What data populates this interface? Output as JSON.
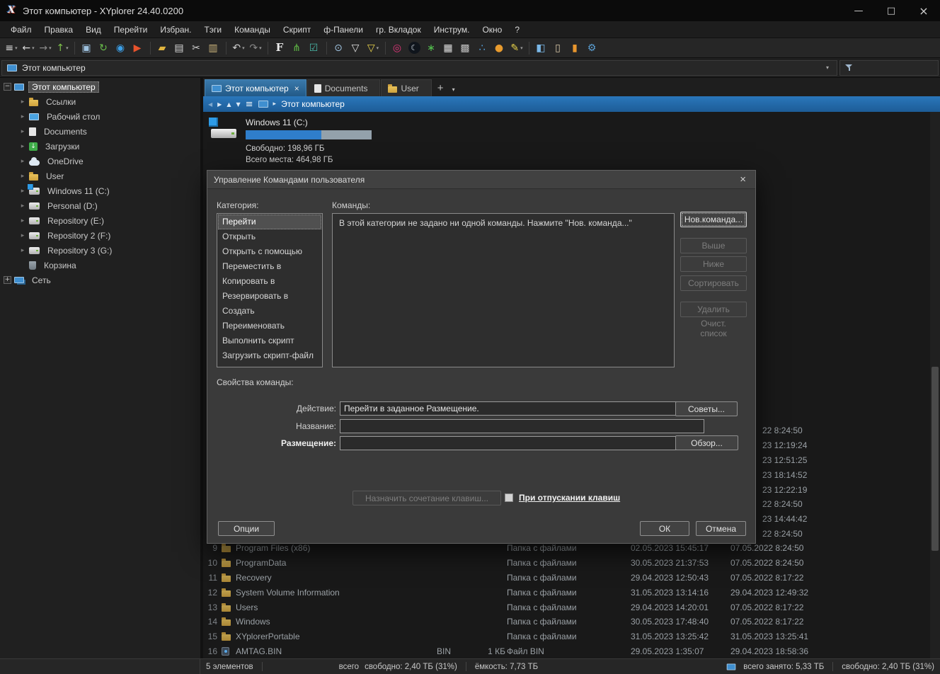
{
  "window": {
    "title": "Этот компьютер - XYplorer 24.40.0200",
    "minimize": "—",
    "maximize": "□",
    "close": "×"
  },
  "menu": {
    "items": [
      {
        "label": "Файл"
      },
      {
        "label": "Правка"
      },
      {
        "label": "Вид"
      },
      {
        "label": "Перейти"
      },
      {
        "label": "Избран."
      },
      {
        "label": "Тэги"
      },
      {
        "label": "Команды"
      },
      {
        "label": "Скрипт"
      },
      {
        "label": "ф-Панели"
      },
      {
        "label": "гр. Вкладок"
      },
      {
        "label": "Инструм."
      },
      {
        "label": "Окно"
      },
      {
        "label": "?"
      }
    ]
  },
  "toolbar": {
    "items": [
      {
        "name": "menu-button",
        "glyph": "≡",
        "color": "#e0e0e0",
        "caret": "▾"
      },
      {
        "name": "back-button",
        "glyph": "←",
        "color": "#d8d8d8",
        "caret": "▾"
      },
      {
        "name": "forward-button",
        "glyph": "→",
        "color": "#8a8a8a",
        "caret": "▾"
      },
      {
        "name": "up-button",
        "glyph": "↑",
        "color": "#7ec24a",
        "caret": "▾"
      },
      {
        "name": "toolbar-separator",
        "cls": "sep"
      },
      {
        "name": "screen-button",
        "glyph": "▣",
        "color": "#9fc3e0"
      },
      {
        "name": "refresh-button",
        "glyph": "↻",
        "color": "#6abf4b"
      },
      {
        "name": "zoom-button",
        "glyph": "◉",
        "color": "#3b9fe8"
      },
      {
        "name": "go-button",
        "glyph": "▶",
        "color": "#e8532c"
      },
      {
        "name": "toolbar-separator",
        "cls": "sep"
      },
      {
        "name": "new-folder-button",
        "glyph": "▰",
        "color": "#e0b43e"
      },
      {
        "name": "copy-button",
        "glyph": "▤",
        "color": "#d8d8d8"
      },
      {
        "name": "cut-button",
        "glyph": "✂",
        "color": "#d0d0d0"
      },
      {
        "name": "paste-button",
        "glyph": "▥",
        "color": "#c9b27a"
      },
      {
        "name": "toolbar-separator",
        "cls": "sep"
      },
      {
        "name": "undo-button",
        "glyph": "↶",
        "color": "#d0d0d0",
        "caret": "▾"
      },
      {
        "name": "redo-button",
        "glyph": "↷",
        "color": "#8a8a8a",
        "caret": "▾"
      },
      {
        "name": "toolbar-separator",
        "cls": "sep"
      },
      {
        "name": "font-button",
        "glyph": "F",
        "color": "#ececec",
        "cls": "serif"
      },
      {
        "name": "tree-style-button",
        "glyph": "⋔",
        "color": "#5fba46"
      },
      {
        "name": "checkbox-select-button",
        "glyph": "☑",
        "color": "#49b8a8"
      },
      {
        "name": "toolbar-separator",
        "cls": "sep"
      },
      {
        "name": "find-files-button",
        "glyph": "⊙",
        "color": "#9fc3e0"
      },
      {
        "name": "filter-button",
        "glyph": "▽",
        "color": "#e0e0e0"
      },
      {
        "name": "visual-filter-button",
        "glyph": "▽",
        "color": "#e8d24a",
        "caret": "▾"
      },
      {
        "name": "toolbar-separator",
        "cls": "sep"
      },
      {
        "name": "hotlist-button",
        "glyph": "◎",
        "color": "#e2357a"
      },
      {
        "name": "dark-mode-button",
        "glyph": "☾",
        "color": "#cdd6e0",
        "cls": "moon"
      },
      {
        "name": "spot-button",
        "glyph": "∗",
        "color": "#54c24e"
      },
      {
        "name": "grid-button",
        "glyph": "▦",
        "color": "#e0e0e0"
      },
      {
        "name": "type-stats-button",
        "glyph": "▩",
        "color": "#c0c0c0"
      },
      {
        "name": "spray-button",
        "glyph": "∴",
        "color": "#58a8e8"
      },
      {
        "name": "color-filter-button",
        "glyph": "●",
        "color": "#e89b2e"
      },
      {
        "name": "highlight-button",
        "glyph": "✎",
        "color": "#e8d24a",
        "caret": "▾"
      },
      {
        "name": "toolbar-separator",
        "cls": "sep"
      },
      {
        "name": "dual-pane-button",
        "glyph": "◧",
        "color": "#7ab8e8"
      },
      {
        "name": "catalog-button",
        "glyph": "▯",
        "color": "#d8c8a8"
      },
      {
        "name": "panel-button",
        "glyph": "▮",
        "color": "#e8962e"
      },
      {
        "name": "settings-wrench-button",
        "glyph": "⚙",
        "color": "#5a9fd4"
      }
    ]
  },
  "addressbar": {
    "value": "Этот компьютер",
    "caret": "▾"
  },
  "tree": {
    "items": [
      {
        "name": "tree-item-this-computer",
        "label": "Этот компьютер",
        "exp": "−",
        "ic": "ic-computer",
        "cls": "lvl0 sel"
      },
      {
        "name": "tree-item-links",
        "label": "Ссылки",
        "exp": "▸",
        "ic": "ic-folder",
        "cls": "lvl1"
      },
      {
        "name": "tree-item-desktop",
        "label": "Рабочий стол",
        "exp": "▸",
        "ic": "ic-desktop",
        "cls": "lvl1"
      },
      {
        "name": "tree-item-documents",
        "label": "Documents",
        "exp": "▸",
        "ic": "ic-doc",
        "cls": "lvl1"
      },
      {
        "name": "tree-item-downloads",
        "label": "Загрузки",
        "exp": "▸",
        "ic": "ic-down",
        "cls": "lvl1"
      },
      {
        "name": "tree-item-onedrive",
        "label": "OneDrive",
        "exp": "▸",
        "ic": "ic-cloud",
        "cls": "lvl1"
      },
      {
        "name": "tree-item-user",
        "label": "User",
        "exp": "▸",
        "ic": "ic-folder",
        "cls": "lvl1"
      },
      {
        "name": "tree-item-drive-c",
        "label": "Windows 11 (C:)",
        "exp": "▸",
        "ic": "ic-drive-win",
        "cls": "lvl1"
      },
      {
        "name": "tree-item-drive-d",
        "label": "Personal (D:)",
        "exp": "▸",
        "ic": "ic-drive",
        "cls": "lvl1"
      },
      {
        "name": "tree-item-drive-e",
        "label": "Repository (E:)",
        "exp": "▸",
        "ic": "ic-drive",
        "cls": "lvl1"
      },
      {
        "name": "tree-item-drive-f",
        "label": "Repository 2 (F:)",
        "exp": "▸",
        "ic": "ic-drive",
        "cls": "lvl1"
      },
      {
        "name": "tree-item-drive-g",
        "label": "Repository 3 (G:)",
        "exp": "▸",
        "ic": "ic-drive",
        "cls": "lvl1"
      },
      {
        "name": "tree-item-recycle-bin",
        "label": "Корзина",
        "exp": "",
        "ic": "ic-bin2",
        "cls": "lvl1"
      },
      {
        "name": "tree-item-network",
        "label": "Сеть",
        "exp": "+",
        "ic": "ic-network",
        "cls": "lvl0"
      }
    ]
  },
  "tabs": {
    "items": [
      {
        "name": "tab-this-computer",
        "label": "Этот компьютер",
        "cls": "active",
        "ic": "ic-computer",
        "close": "×"
      },
      {
        "name": "tab-documents",
        "label": "Documents",
        "ic": "ic-doc"
      },
      {
        "name": "tab-user",
        "label": "User",
        "ic": "ic-folder"
      }
    ],
    "new_tab": "+",
    "caret": "▾"
  },
  "breadcrumb": {
    "arrows": [
      {
        "name": "breadcrumb-back-icon",
        "glyph": "◀",
        "color": "#7fa9ce"
      },
      {
        "name": "breadcrumb-forward-icon",
        "glyph": "▶",
        "color": "#dbe9f6"
      },
      {
        "name": "breadcrumb-up-icon",
        "glyph": "▲",
        "color": "#dbe9f6"
      },
      {
        "name": "breadcrumb-down-icon",
        "glyph": "▼",
        "color": "#dbe9f6"
      }
    ],
    "menu": "≡",
    "chevron": "▸",
    "path": "Этот компьютер"
  },
  "drive": {
    "name": "Windows 11 (C:)",
    "free": "Свободно: 198,96 ГБ",
    "total": "Всего места: 464,98 ГБ",
    "used_percent": 60
  },
  "files": {
    "rows": [
      {
        "num": "9",
        "ic": "ic-folder",
        "name": "Program Files (x86)",
        "ext": "",
        "size": "",
        "type": "Папка с файлами",
        "modified": "02.05.2023 15:45:17",
        "created": "07.05.2022 8:24:50"
      },
      {
        "num": "10",
        "ic": "ic-folder",
        "name": "ProgramData",
        "ext": "",
        "size": "",
        "type": "Папка с файлами",
        "modified": "30.05.2023 21:37:53",
        "created": "07.05.2022 8:24:50"
      },
      {
        "num": "11",
        "ic": "ic-folder",
        "name": "Recovery",
        "ext": "",
        "size": "",
        "type": "Папка с файлами",
        "modified": "29.04.2023 12:50:43",
        "created": "07.05.2022 8:17:22"
      },
      {
        "num": "12",
        "ic": "ic-folder",
        "name": "System Volume Information",
        "ext": "",
        "size": "",
        "type": "Папка с файлами",
        "modified": "31.05.2023 13:14:16",
        "created": "29.04.2023 12:49:32"
      },
      {
        "num": "13",
        "ic": "ic-folder",
        "name": "Users",
        "ext": "",
        "size": "",
        "type": "Папка с файлами",
        "modified": "29.04.2023 14:20:01",
        "created": "07.05.2022 8:17:22"
      },
      {
        "num": "14",
        "ic": "ic-folder",
        "name": "Windows",
        "ext": "",
        "size": "",
        "type": "Папка с файлами",
        "modified": "30.05.2023 17:48:40",
        "created": "07.05.2022 8:17:22"
      },
      {
        "num": "15",
        "ic": "ic-folder",
        "name": "XYplorerPortable",
        "ext": "",
        "size": "",
        "type": "Папка с файлами",
        "modified": "31.05.2023 13:25:42",
        "created": "31.05.2023 13:25:41"
      },
      {
        "num": "16",
        "ic": "ic-binfile",
        "name": "AMTAG.BIN",
        "ext": "BIN",
        "size": "1 КБ",
        "type": "Файл BIN",
        "modified": "29.05.2023 1:35:07",
        "created": "29.04.2023 18:58:36"
      }
    ],
    "peek_dates": [
      "22 8:24:50",
      "23 12:19:24",
      "23 12:51:25",
      "23 18:14:52",
      "23 12:22:19",
      "22 8:24:50",
      "23 14:44:42",
      "22 8:24:50"
    ]
  },
  "statusbar": {
    "items_count": "5 элементов",
    "seg_total": "всего",
    "seg_free": "свободно: 2,40 ТБ (31%)",
    "seg_capacity": "ёмкость: 7,73 ТБ",
    "right_used": "всего занято: 5,33 ТБ",
    "right_free": "свободно: 2,40 ТБ (31%)"
  },
  "dialog": {
    "title": "Управление Командами пользователя",
    "close": "×",
    "category_label": "Категория:",
    "commands_label": "Команды:",
    "categories": [
      {
        "label": "Перейти",
        "cls": "sel"
      },
      {
        "label": "Открыть"
      },
      {
        "label": "Открыть с помощью"
      },
      {
        "label": "Переместить в"
      },
      {
        "label": "Копировать в"
      },
      {
        "label": "Резервировать в"
      },
      {
        "label": "Создать"
      },
      {
        "label": "Переименовать"
      },
      {
        "label": "Выполнить скрипт"
      },
      {
        "label": "Загрузить скрипт-файл"
      }
    ],
    "empty_text": "В этой категории не задано ни одной команды. Нажмите \"Нов. команда...\"",
    "side_buttons": [
      {
        "name": "new-command-button",
        "label": "Нов.команда...",
        "cls": "focused gap-lg"
      },
      {
        "name": "move-up-button",
        "label": "Выше",
        "cls": "disabled gap-sm"
      },
      {
        "name": "move-down-button",
        "label": "Ниже",
        "cls": "disabled gap-md"
      },
      {
        "name": "sort-button",
        "label": "Сортировать",
        "cls": "disabled gap-lg"
      },
      {
        "name": "delete-button",
        "label": "Удалить",
        "cls": "disabled gap-md"
      },
      {
        "name": "clear-list-button",
        "label": "Очист. список",
        "cls": "disabled flat"
      }
    ],
    "props_label": "Свойства команды:",
    "action_label": "Действие:",
    "action_value": "Перейти в заданное Размещение.",
    "tips_button": "Советы...",
    "name_label": "Название:",
    "location_label": "Размещение:",
    "browse_button": "Обзор...",
    "hotkey_button": "Назначить сочетание клавиш...",
    "checkbox_label": "При отпускании клавиш",
    "options_button": "Опции",
    "ok_button": "ОК",
    "cancel_button": "Отмена"
  }
}
